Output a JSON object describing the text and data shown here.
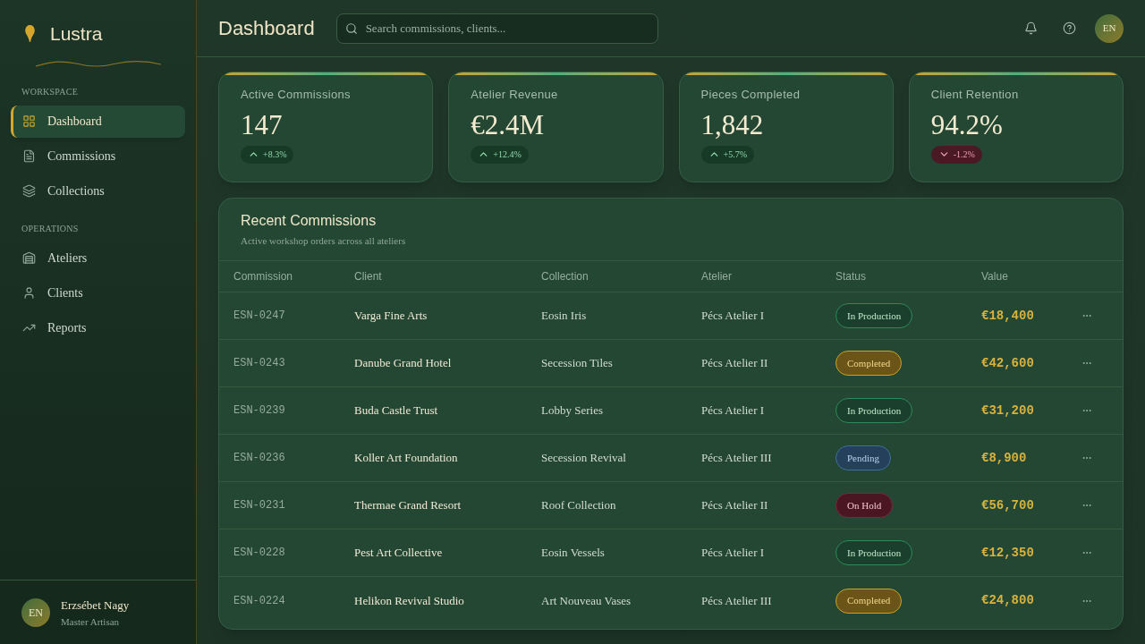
{
  "sidebar": {
    "brand": "Lustra",
    "sections": [
      {
        "label": "WORKSPACE",
        "items": [
          {
            "label": "Dashboard",
            "selected": true
          },
          {
            "label": "Commissions",
            "selected": false
          },
          {
            "label": "Collections",
            "selected": false
          }
        ]
      },
      {
        "label": "OPERATIONS",
        "items": [
          {
            "label": "Ateliers",
            "selected": false
          },
          {
            "label": "Clients",
            "selected": false
          },
          {
            "label": "Reports",
            "selected": false
          }
        ]
      }
    ],
    "user": {
      "initials": "EN",
      "name": "Erzsébet Nagy",
      "role": "Master Artisan"
    }
  },
  "header": {
    "title": "Dashboard",
    "search": {
      "placeholder": "Search commissions, clients..."
    },
    "avatar": "EN"
  },
  "stats": [
    {
      "label": "Active Commissions",
      "value": "147",
      "change": {
        "kind": "up",
        "text": "+8.3%"
      }
    },
    {
      "label": "Atelier Revenue",
      "value": "€2.4M",
      "change": {
        "kind": "up",
        "text": "+12.4%"
      }
    },
    {
      "label": "Pieces Completed",
      "value": "1,842",
      "change": {
        "kind": "up",
        "text": "+5.7%"
      }
    },
    {
      "label": "Client Retention",
      "value": "94.2%",
      "change": {
        "kind": "down",
        "text": "-1.2%"
      }
    }
  ],
  "table": {
    "title": "Recent Commissions",
    "subtitle": "Active workshop orders across all ateliers",
    "columns": [
      "Commission",
      "Client",
      "Collection",
      "Atelier",
      "Status",
      "Value"
    ],
    "rows": [
      {
        "commission": "ESN-0247",
        "client": "Varga Fine Arts",
        "collection": "Eosin Iris",
        "atelier": "Pécs Atelier I",
        "status": {
          "kind": "production",
          "label": "In Production"
        },
        "value": "€18,400"
      },
      {
        "commission": "ESN-0243",
        "client": "Danube Grand Hotel",
        "collection": "Secession Tiles",
        "atelier": "Pécs Atelier II",
        "status": {
          "kind": "completed",
          "label": "Completed"
        },
        "value": "€42,600"
      },
      {
        "commission": "ESN-0239",
        "client": "Buda Castle Trust",
        "collection": "Lobby Series",
        "atelier": "Pécs Atelier I",
        "status": {
          "kind": "production",
          "label": "In Production"
        },
        "value": "€31,200"
      },
      {
        "commission": "ESN-0236",
        "client": "Koller Art Foundation",
        "collection": "Secession Revival",
        "atelier": "Pécs Atelier III",
        "status": {
          "kind": "pending",
          "label": "Pending"
        },
        "value": "€8,900"
      },
      {
        "commission": "ESN-0231",
        "client": "Thermae Grand Resort",
        "collection": "Roof Collection",
        "atelier": "Pécs Atelier II",
        "status": {
          "kind": "hold",
          "label": "On Hold"
        },
        "value": "€56,700"
      },
      {
        "commission": "ESN-0228",
        "client": "Pest Art Collective",
        "collection": "Eosin Vessels",
        "atelier": "Pécs Atelier I",
        "status": {
          "kind": "production",
          "label": "In Production"
        },
        "value": "€12,350"
      },
      {
        "commission": "ESN-0224",
        "client": "Helikon Revival Studio",
        "collection": "Art Nouveau Vases",
        "atelier": "Pécs Atelier III",
        "status": {
          "kind": "completed",
          "label": "Completed"
        },
        "value": "€24,800"
      }
    ]
  }
}
